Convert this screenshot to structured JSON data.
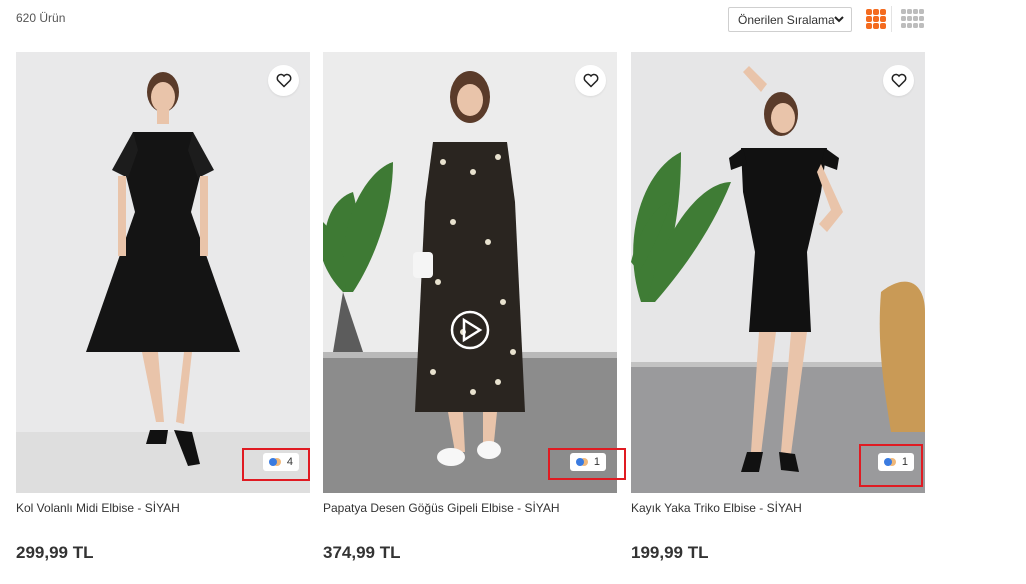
{
  "listing": {
    "product_count": "620 Ürün",
    "sort_selected": "Önerilen Sıralama",
    "accent_color": "#f46b1f"
  },
  "products": [
    {
      "title": "Kol Volanlı Midi Elbise - SİYAH",
      "price": "299,99 TL",
      "color_count": "4",
      "has_video": false
    },
    {
      "title": "Papatya Desen Göğüs Gipeli Elbise - SİYAH",
      "price": "374,99 TL",
      "color_count": "1",
      "has_video": true
    },
    {
      "title": "Kayık Yaka Triko Elbise - SİYAH",
      "price": "199,99 TL",
      "color_count": "1",
      "has_video": false
    }
  ],
  "icons": {
    "favorite": "heart-icon",
    "colors": "color-swatch-icon",
    "video": "play-icon",
    "grid_3": "grid-3-icon",
    "grid_4": "grid-4-icon",
    "sort": "chevron-down-icon"
  }
}
